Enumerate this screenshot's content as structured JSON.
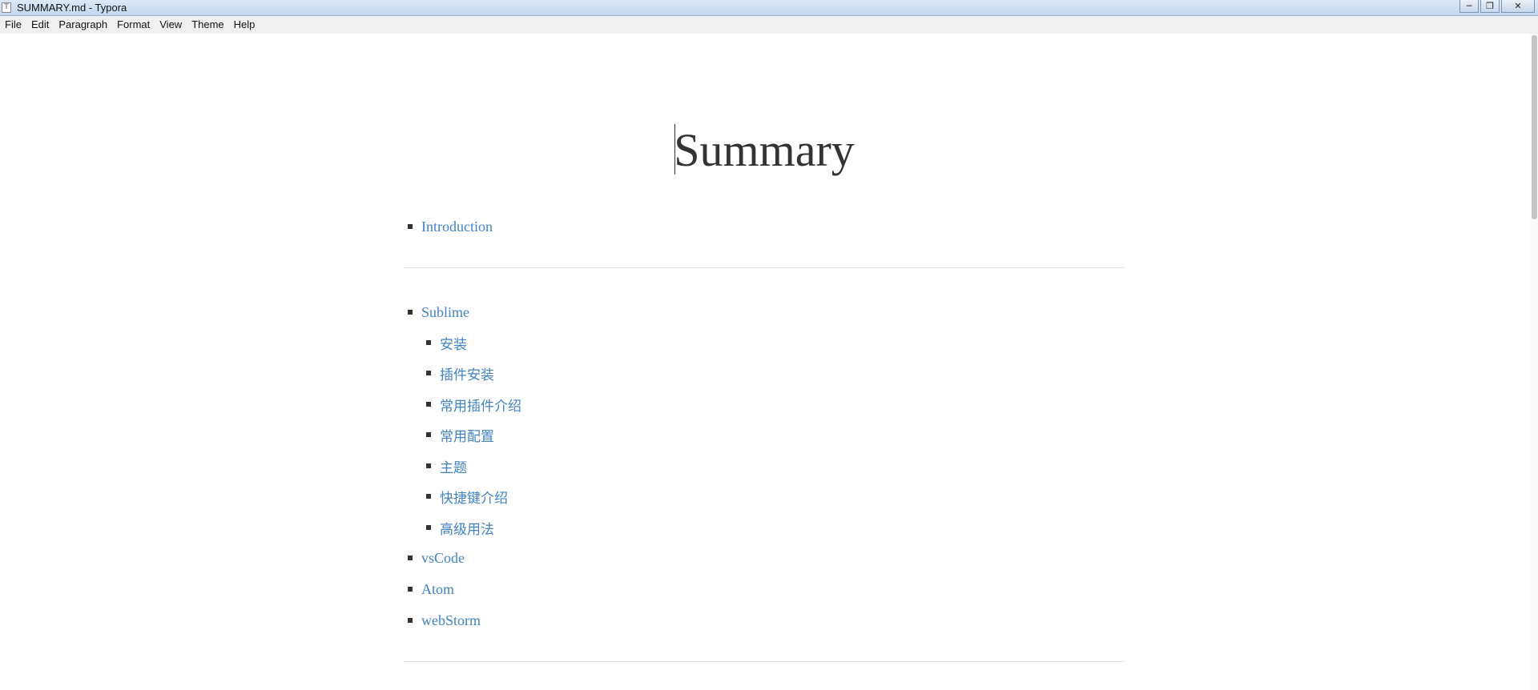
{
  "window": {
    "title": "SUMMARY.md - Typora",
    "app_icon_letter": "T",
    "controls": {
      "minimize": "─",
      "restore": "❐",
      "close": "✕"
    }
  },
  "menubar": {
    "items": [
      "File",
      "Edit",
      "Paragraph",
      "Format",
      "View",
      "Theme",
      "Help"
    ]
  },
  "document": {
    "title": "Summary",
    "link_color": "#4183c4",
    "sections": [
      {
        "items": [
          {
            "label": "Introduction"
          }
        ]
      },
      {
        "items": [
          {
            "label": "Sublime",
            "children": [
              "安装",
              "插件安装",
              "常用插件介绍",
              "常用配置",
              "主题",
              "快捷键介绍",
              "高级用法"
            ]
          },
          {
            "label": "vsCode"
          },
          {
            "label": "Atom"
          },
          {
            "label": "webStorm"
          }
        ]
      }
    ]
  }
}
